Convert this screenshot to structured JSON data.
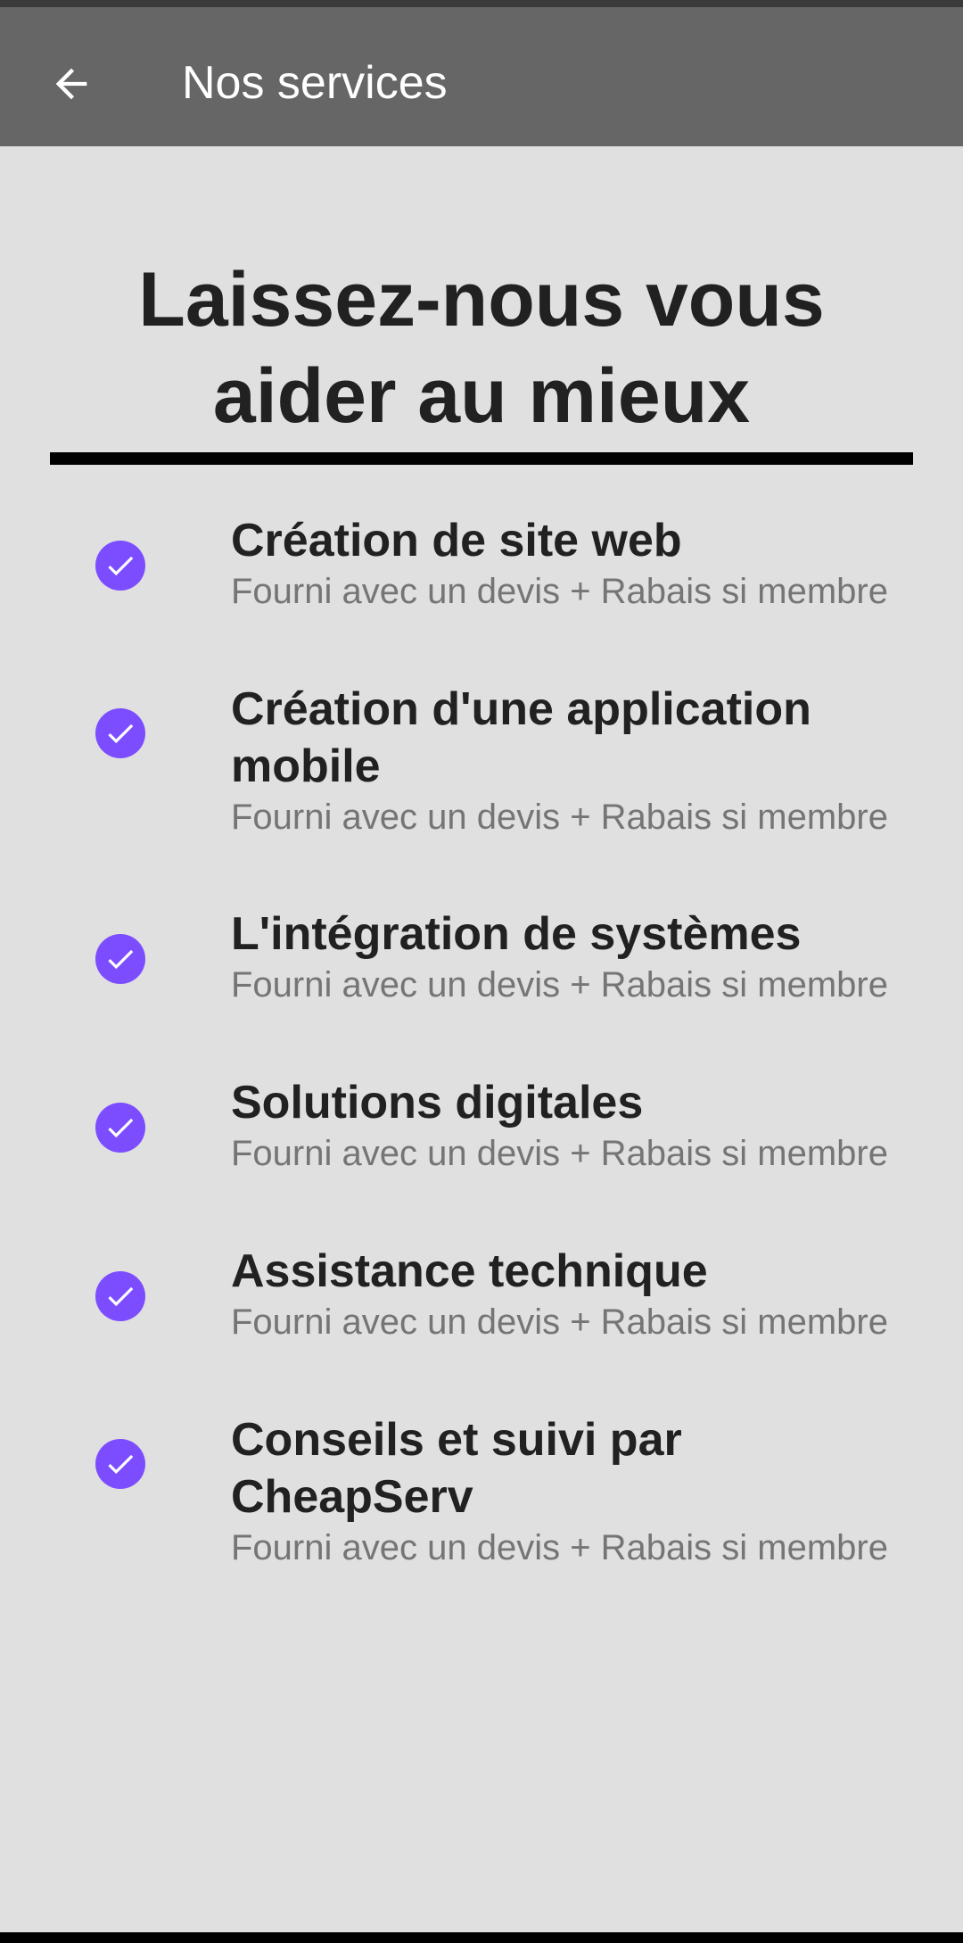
{
  "app_bar": {
    "title": "Nos services",
    "back_icon": "arrow-left-icon"
  },
  "main": {
    "headline": "Laissez-nous vous aider au mieux",
    "services": [
      {
        "icon": "check-circle-icon",
        "title": "Création de site web",
        "description": "Fourni avec un devis + Rabais si membre"
      },
      {
        "icon": "check-circle-icon",
        "title": "Création d'une application mobile",
        "description": "Fourni avec un devis + Rabais si membre"
      },
      {
        "icon": "check-circle-icon",
        "title": "L'intégration de systèmes",
        "description": "Fourni avec un devis + Rabais si membre"
      },
      {
        "icon": "check-circle-icon",
        "title": "Solutions digitales",
        "description": "Fourni avec un devis + Rabais si membre"
      },
      {
        "icon": "check-circle-icon",
        "title": "Assistance technique",
        "description": "Fourni avec un devis + Rabais si membre"
      },
      {
        "icon": "check-circle-icon",
        "title": "Conseils et suivi par CheapServ",
        "description": "Fourni avec un devis + Rabais si membre"
      }
    ]
  },
  "colors": {
    "app_bar": "#666666",
    "background": "#e0e0e0",
    "accent": "#7c4dff",
    "title_text": "#212121",
    "secondary_text": "#757575"
  }
}
